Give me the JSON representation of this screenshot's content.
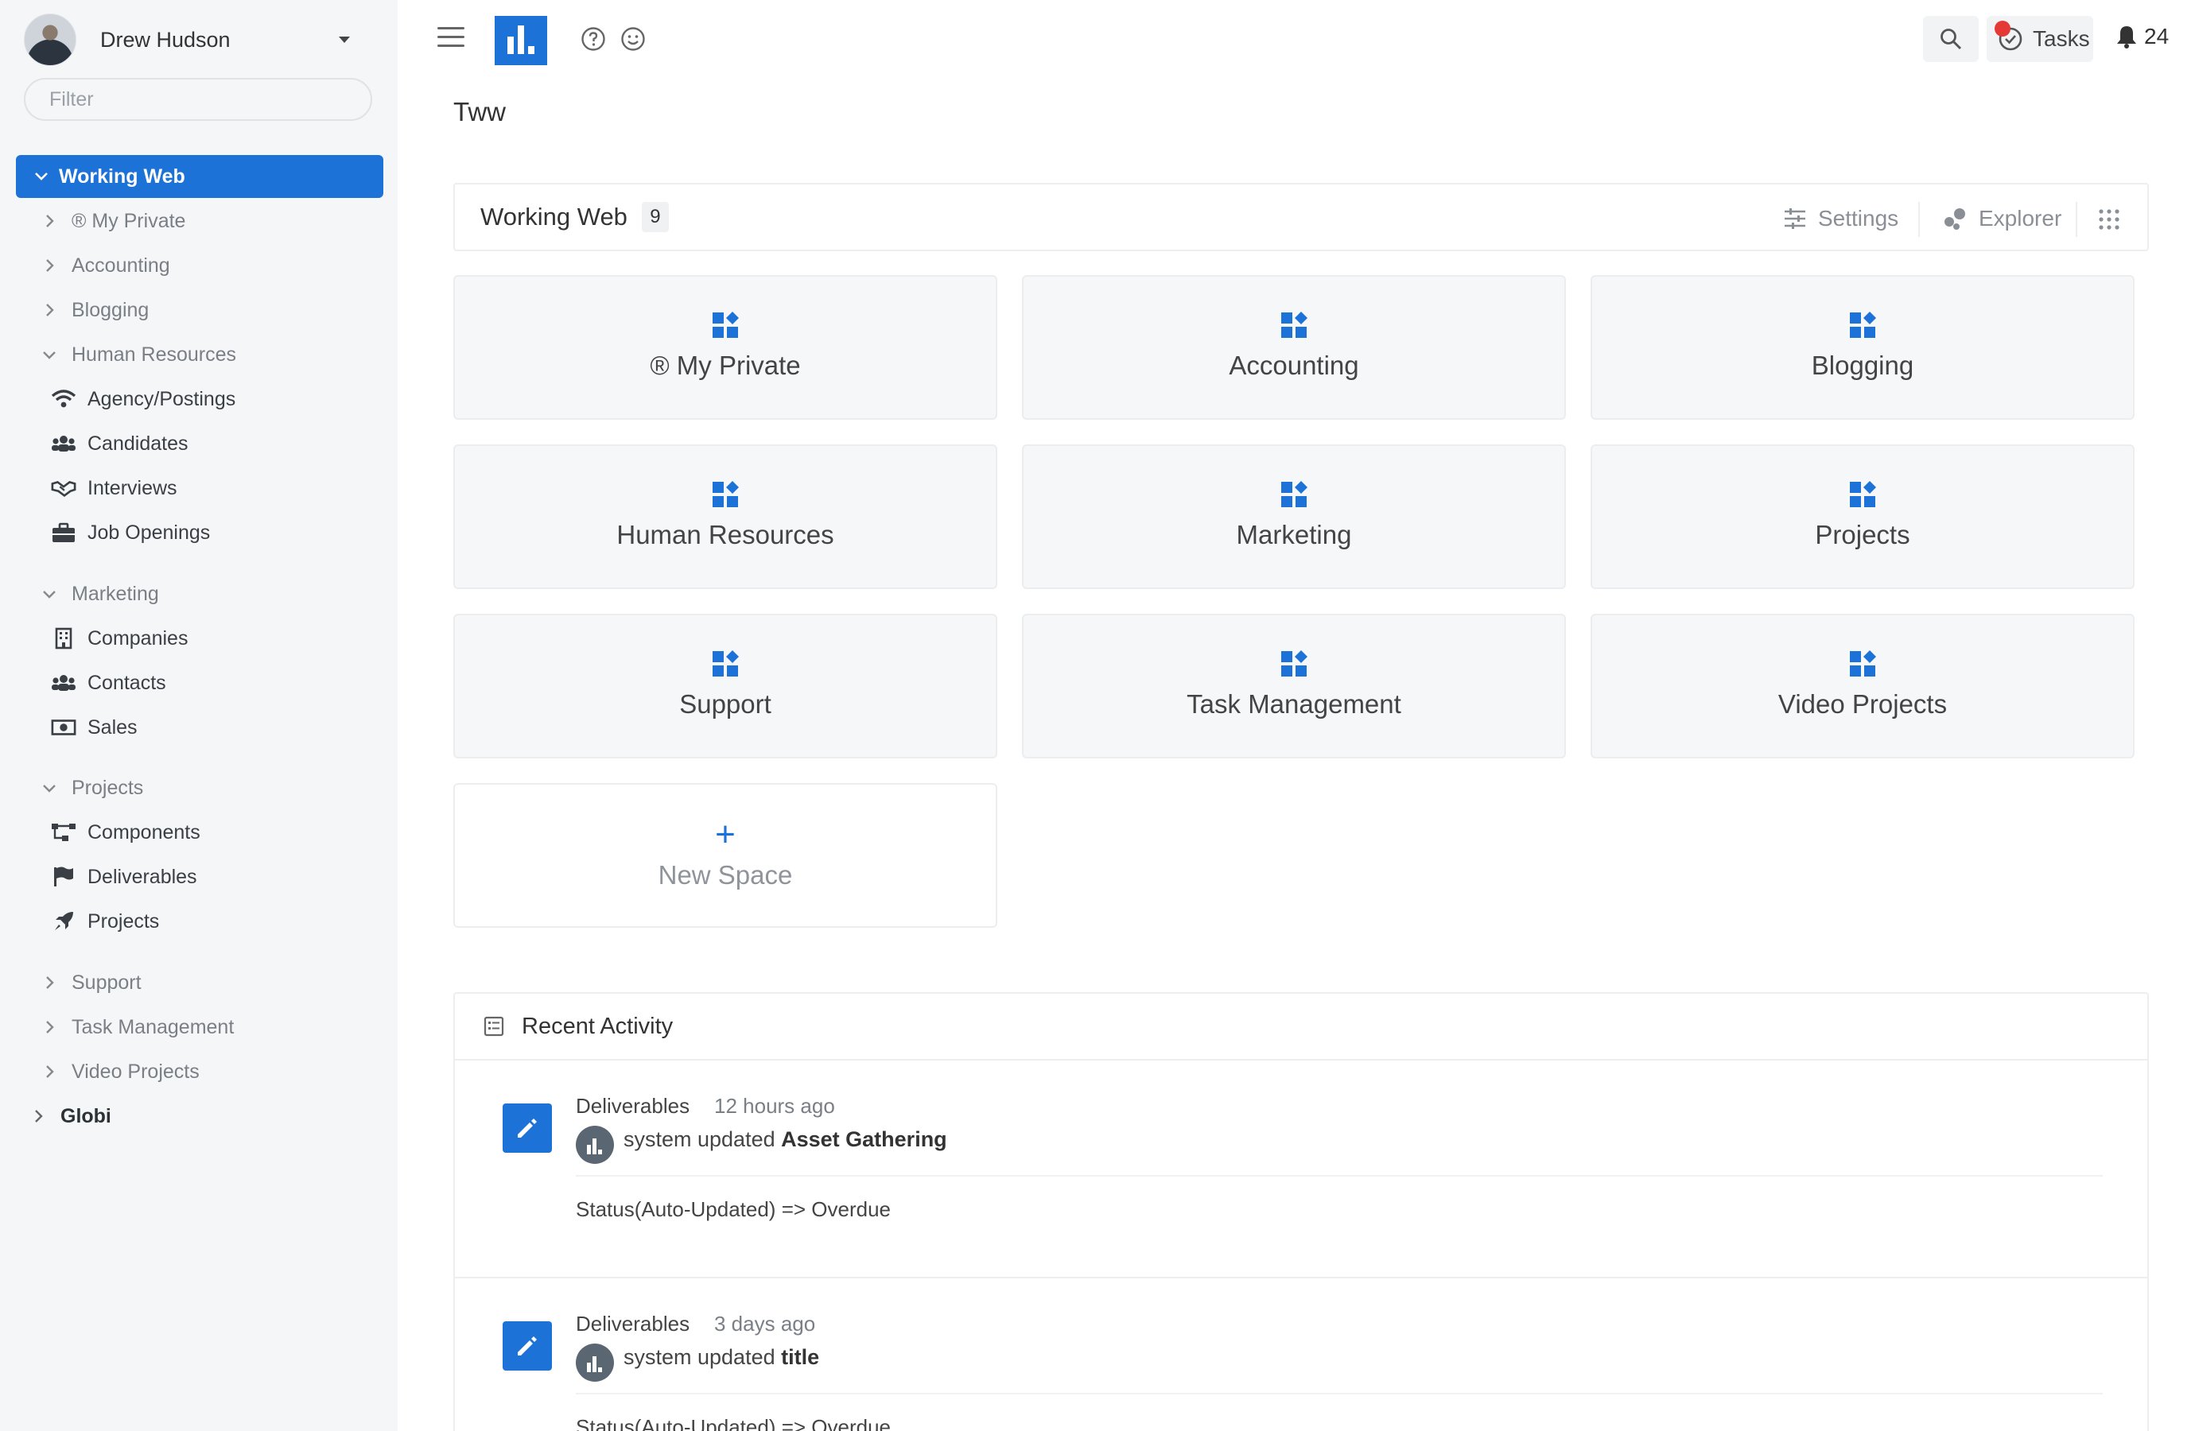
{
  "user": {
    "name": "Drew Hudson"
  },
  "filter": {
    "placeholder": "Filter"
  },
  "sidebar": {
    "active": "Working Web",
    "items": [
      {
        "label": "® My Private"
      },
      {
        "label": "Accounting"
      },
      {
        "label": "Blogging"
      },
      {
        "label": "Human Resources"
      },
      {
        "label": "Agency/Postings",
        "icon": "wifi-icon"
      },
      {
        "label": "Candidates",
        "icon": "users-icon"
      },
      {
        "label": "Interviews",
        "icon": "handshake-icon"
      },
      {
        "label": "Job Openings",
        "icon": "briefcase-icon"
      },
      {
        "label": "Marketing"
      },
      {
        "label": "Companies",
        "icon": "building-icon"
      },
      {
        "label": "Contacts",
        "icon": "users-icon"
      },
      {
        "label": "Sales",
        "icon": "money-icon"
      },
      {
        "label": "Projects"
      },
      {
        "label": "Components",
        "icon": "sitemap-icon"
      },
      {
        "label": "Deliverables",
        "icon": "flag-icon"
      },
      {
        "label": "Projects",
        "icon": "rocket-icon"
      },
      {
        "label": "Support"
      },
      {
        "label": "Task Management"
      },
      {
        "label": "Video Projects"
      },
      {
        "label": "Globi"
      }
    ]
  },
  "topbar": {
    "tasks_label": "Tasks",
    "notifications": "24"
  },
  "page": {
    "title": "Tww"
  },
  "space": {
    "title": "Working Web",
    "count": "9",
    "settings_label": "Settings",
    "explorer_label": "Explorer",
    "cards": [
      {
        "label": "® My Private"
      },
      {
        "label": "Accounting"
      },
      {
        "label": "Blogging"
      },
      {
        "label": "Human Resources"
      },
      {
        "label": "Marketing"
      },
      {
        "label": "Projects"
      },
      {
        "label": "Support"
      },
      {
        "label": "Task Management"
      },
      {
        "label": "Video Projects"
      }
    ],
    "new_label": "New Space"
  },
  "activity": {
    "title": "Recent Activity",
    "items": [
      {
        "space": "Deliverables",
        "time": "12 hours ago",
        "actor": "system updated",
        "target": "Asset Gathering",
        "detail": "Status(Auto-Updated) => Overdue"
      },
      {
        "space": "Deliverables",
        "time": "3 days ago",
        "actor": "system updated",
        "target": "title",
        "detail": "Status(Auto-Updated) => Overdue"
      }
    ]
  },
  "colors": {
    "accent": "#1d72d8",
    "sidebar_bg": "#f5f6f7",
    "notif_dot": "#e53935"
  }
}
